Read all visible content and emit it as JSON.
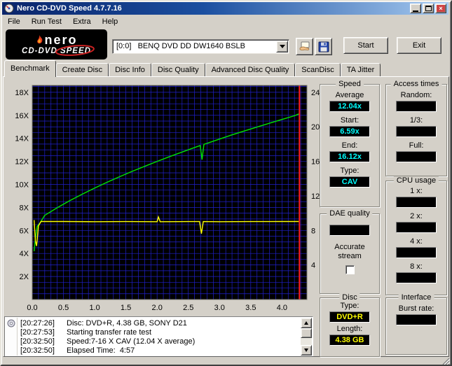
{
  "window": {
    "title": "Nero CD-DVD Speed 4.7.7.16"
  },
  "menu": {
    "items": [
      "File",
      "Run Test",
      "Extra",
      "Help"
    ]
  },
  "logo": {
    "brand": "nero",
    "line1": "CD-DVD",
    "line2": "SPEED"
  },
  "toolbar": {
    "drive": "[0:0]   BENQ DVD DD DW1640 BSLB",
    "start": "Start",
    "exit": "Exit"
  },
  "tabs": {
    "items": [
      "Benchmark",
      "Create Disc",
      "Disc Info",
      "Disc Quality",
      "Advanced Disc Quality",
      "ScanDisc",
      "TA Jitter"
    ],
    "active": "Benchmark"
  },
  "chart_data": {
    "type": "line",
    "bg": "#000000",
    "grid": {
      "color": "#2020cd",
      "x_step": 0.1,
      "y_step": 0.5
    },
    "xlim": [
      0,
      4.4
    ],
    "ylim_left": [
      0,
      18.6
    ],
    "ylim_right": [
      0,
      24.8
    ],
    "x_ticks": [
      {
        "v": 0,
        "t": "0.0"
      },
      {
        "v": 0.5,
        "t": "0.5"
      },
      {
        "v": 1,
        "t": "1.0"
      },
      {
        "v": 1.5,
        "t": "1.5"
      },
      {
        "v": 2,
        "t": "2.0"
      },
      {
        "v": 2.5,
        "t": "2.5"
      },
      {
        "v": 3,
        "t": "3.0"
      },
      {
        "v": 3.5,
        "t": "3.5"
      },
      {
        "v": 4,
        "t": "4.0"
      }
    ],
    "y_left_ticks": [
      {
        "v": 2,
        "t": "2X"
      },
      {
        "v": 4,
        "t": "4X"
      },
      {
        "v": 6,
        "t": "6X"
      },
      {
        "v": 8,
        "t": "8X"
      },
      {
        "v": 10,
        "t": "10X"
      },
      {
        "v": 12,
        "t": "12X"
      },
      {
        "v": 14,
        "t": "14X"
      },
      {
        "v": 16,
        "t": "16X"
      },
      {
        "v": 18,
        "t": "18X"
      }
    ],
    "y_right_ticks": [
      {
        "v": 4,
        "t": "4"
      },
      {
        "v": 8,
        "t": "8"
      },
      {
        "v": 12,
        "t": "12"
      },
      {
        "v": 16,
        "t": "16"
      },
      {
        "v": 20,
        "t": "20"
      },
      {
        "v": 24,
        "t": "24"
      }
    ],
    "series": [
      {
        "name": "read_transfer_rate",
        "color": "#00e400",
        "points": [
          [
            0.03,
            4.2
          ],
          [
            0.05,
            5.3
          ],
          [
            0.08,
            6.35
          ],
          [
            0.12,
            6.62
          ],
          [
            0.2,
            7.31
          ],
          [
            0.4,
            7.97
          ],
          [
            0.6,
            8.58
          ],
          [
            0.8,
            9.15
          ],
          [
            1.0,
            9.68
          ],
          [
            1.2,
            10.19
          ],
          [
            1.4,
            10.67
          ],
          [
            1.6,
            11.13
          ],
          [
            1.8,
            11.57
          ],
          [
            2.0,
            12.0
          ],
          [
            2.2,
            12.41
          ],
          [
            2.4,
            12.81
          ],
          [
            2.6,
            13.2
          ],
          [
            2.69,
            13.37
          ],
          [
            2.72,
            12.15
          ],
          [
            2.75,
            13.48
          ],
          [
            2.8,
            13.57
          ],
          [
            3.0,
            13.94
          ],
          [
            3.2,
            14.3
          ],
          [
            3.4,
            14.64
          ],
          [
            3.6,
            14.98
          ],
          [
            3.8,
            15.31
          ],
          [
            4.0,
            15.64
          ],
          [
            4.2,
            15.96
          ],
          [
            4.27,
            16.12
          ]
        ]
      },
      {
        "name": "rotation_speed",
        "color": "#ffff00",
        "points": [
          [
            0.03,
            6.9
          ],
          [
            0.05,
            5.1
          ],
          [
            0.07,
            4.65
          ],
          [
            0.1,
            6.4
          ],
          [
            0.14,
            6.78
          ],
          [
            0.5,
            6.78
          ],
          [
            1.0,
            6.76
          ],
          [
            1.5,
            6.77
          ],
          [
            2.0,
            6.76
          ],
          [
            2.02,
            7.18
          ],
          [
            2.05,
            6.76
          ],
          [
            2.5,
            6.77
          ],
          [
            2.68,
            6.77
          ],
          [
            2.71,
            5.72
          ],
          [
            2.74,
            6.77
          ],
          [
            3.0,
            6.76
          ],
          [
            3.5,
            6.77
          ],
          [
            4.0,
            6.78
          ],
          [
            4.27,
            6.78
          ]
        ]
      }
    ],
    "markers": [
      {
        "type": "vline",
        "x": 4.28,
        "color": "#ff1a1a"
      }
    ]
  },
  "panels": {
    "speed": {
      "title": "Speed",
      "rows": [
        {
          "label": "Average",
          "value": "12.04x"
        },
        {
          "label": "Start:",
          "value": "6.59x"
        },
        {
          "label": "End:",
          "value": "16.12x"
        },
        {
          "label": "Type:",
          "value": "CAV"
        }
      ]
    },
    "access": {
      "title": "Access times",
      "rows": [
        {
          "label": "Random:",
          "value": ""
        },
        {
          "label": "1/3:",
          "value": ""
        },
        {
          "label": "Full:",
          "value": ""
        }
      ]
    },
    "dae": {
      "title": "DAE quality",
      "value": "",
      "line1": "Accurate",
      "line2": "stream"
    },
    "cpu": {
      "title": "CPU usage",
      "rows": [
        {
          "label": "1 x:",
          "value": ""
        },
        {
          "label": "2 x:",
          "value": ""
        },
        {
          "label": "4 x:",
          "value": ""
        },
        {
          "label": "8 x:",
          "value": ""
        }
      ]
    },
    "disc": {
      "title": "Disc",
      "rows": [
        {
          "label": "Type:",
          "value": "DVD+R"
        },
        {
          "label": "Length:",
          "value": "4.38 GB"
        }
      ]
    },
    "iface": {
      "title": "Interface",
      "rows": [
        {
          "label": "Burst rate:",
          "value": ""
        }
      ]
    }
  },
  "log": {
    "entries": [
      {
        "time": "[20:27:26]",
        "text": "Disc: DVD+R, 4.38 GB, SONY D21"
      },
      {
        "time": "[20:27:53]",
        "text": "Starting transfer rate test"
      },
      {
        "time": "[20:32:50]",
        "text": "Speed:7-16 X CAV (12.04 X average)"
      },
      {
        "time": "[20:32:50]",
        "text": "Elapsed Time:  4:57"
      }
    ]
  }
}
